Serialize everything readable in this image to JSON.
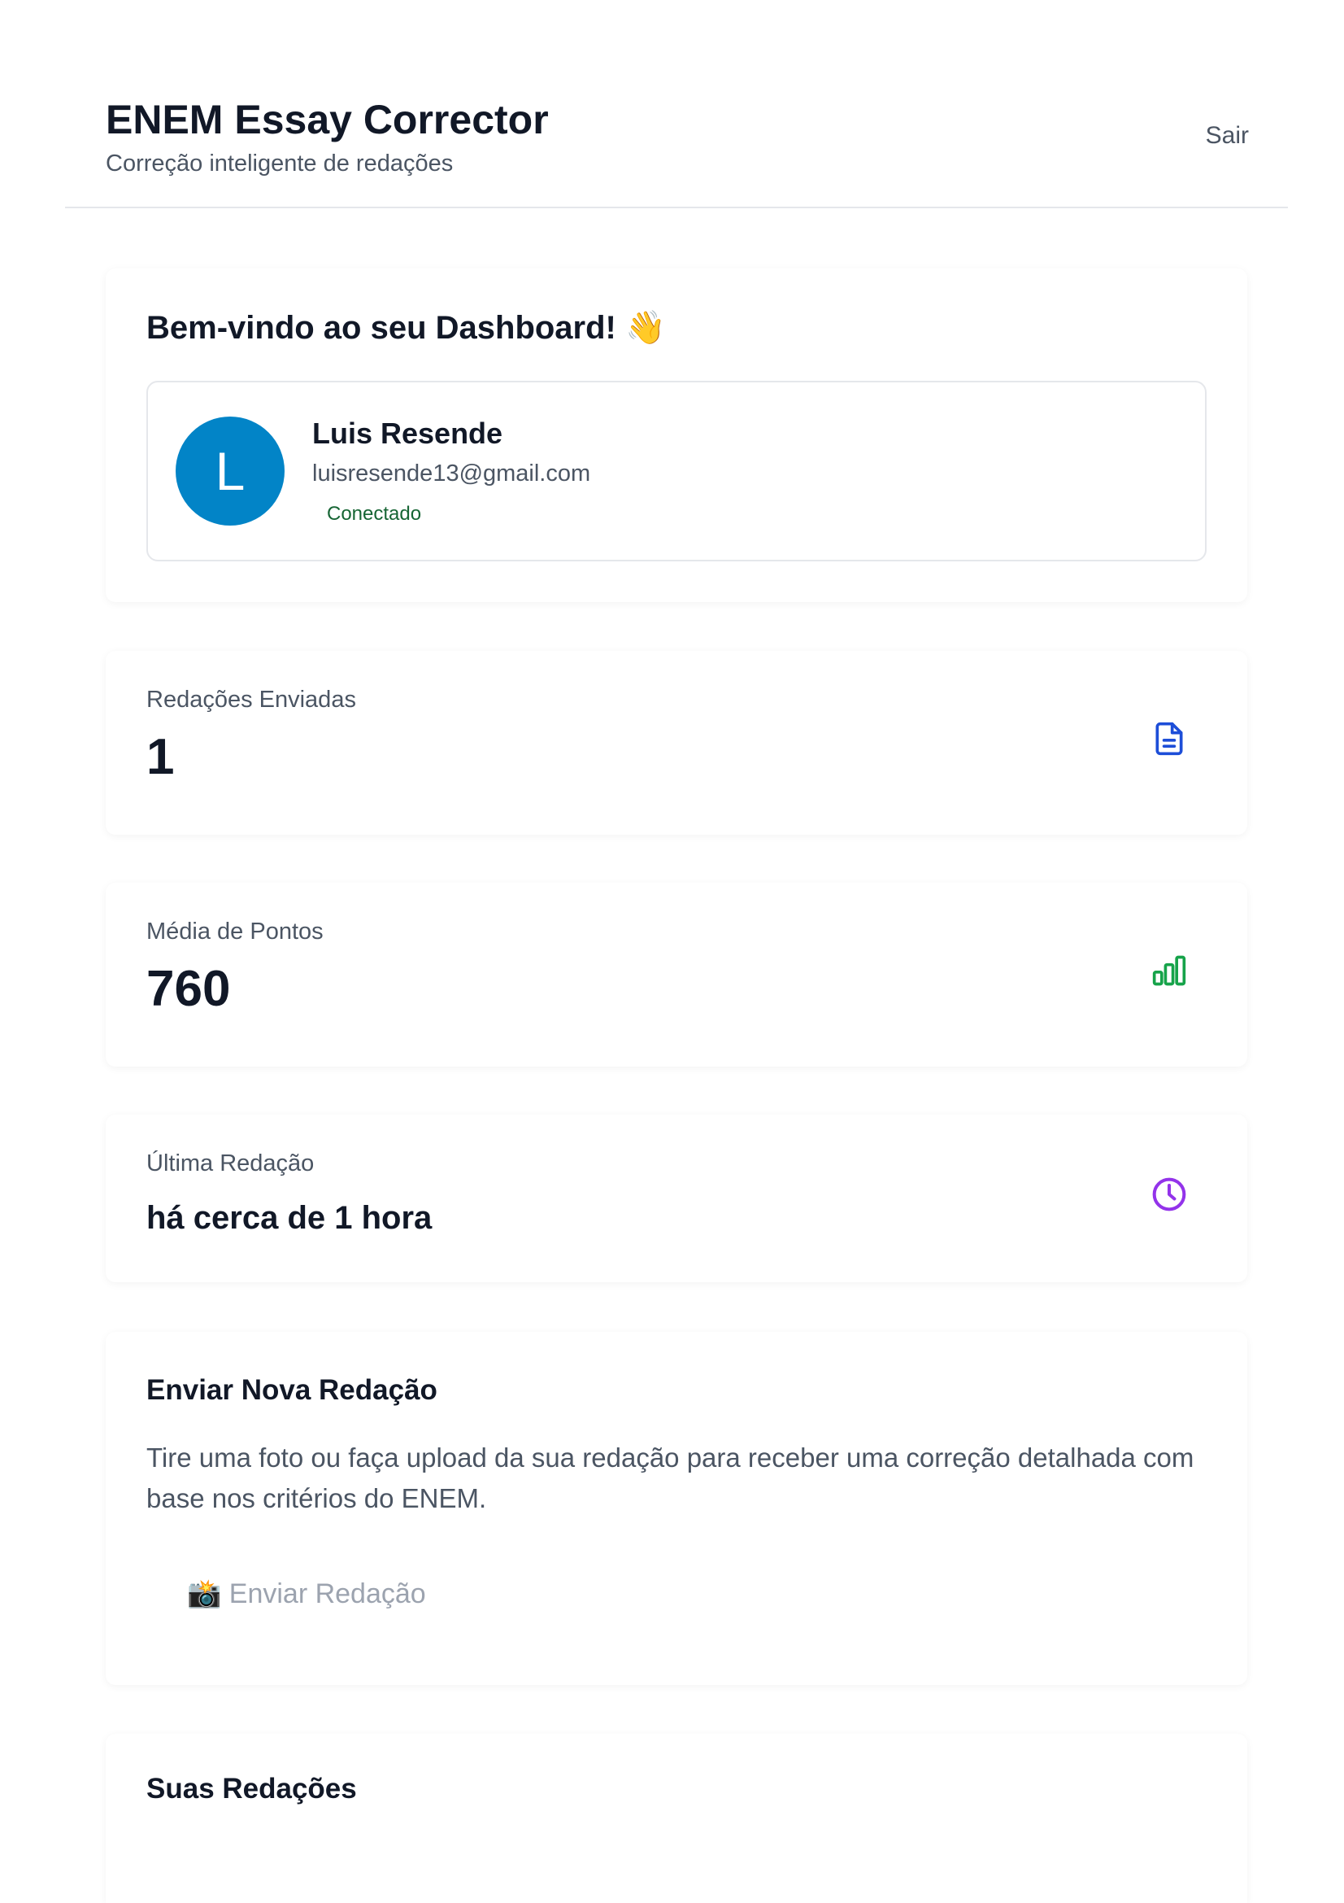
{
  "header": {
    "title": "ENEM Essay Corrector",
    "subtitle": "Correção inteligente de redações",
    "logout_label": "Sair"
  },
  "welcome": {
    "title": "Bem-vindo ao seu Dashboard! 👋",
    "user": {
      "avatar_initial": "L",
      "name": "Luis Resende",
      "email": "luisresende13@gmail.com",
      "status": "Conectado"
    }
  },
  "stats": [
    {
      "label": "Redações Enviadas",
      "value": "1",
      "icon": "document-icon",
      "color": "#1d4ed8"
    },
    {
      "label": "Média de Pontos",
      "value": "760",
      "icon": "bar-chart-icon",
      "color": "#16a34a"
    },
    {
      "label": "Última Redação",
      "value": "há cerca de 1 hora",
      "icon": "clock-icon",
      "color": "#9333ea"
    }
  ],
  "upload": {
    "title": "Enviar Nova Redação",
    "description": "Tire uma foto ou faça upload da sua redação para receber uma correção detalhada com base nos critérios do ENEM.",
    "button_label": "📸 Enviar Redação"
  },
  "essays": {
    "title": "Suas Redações"
  }
}
